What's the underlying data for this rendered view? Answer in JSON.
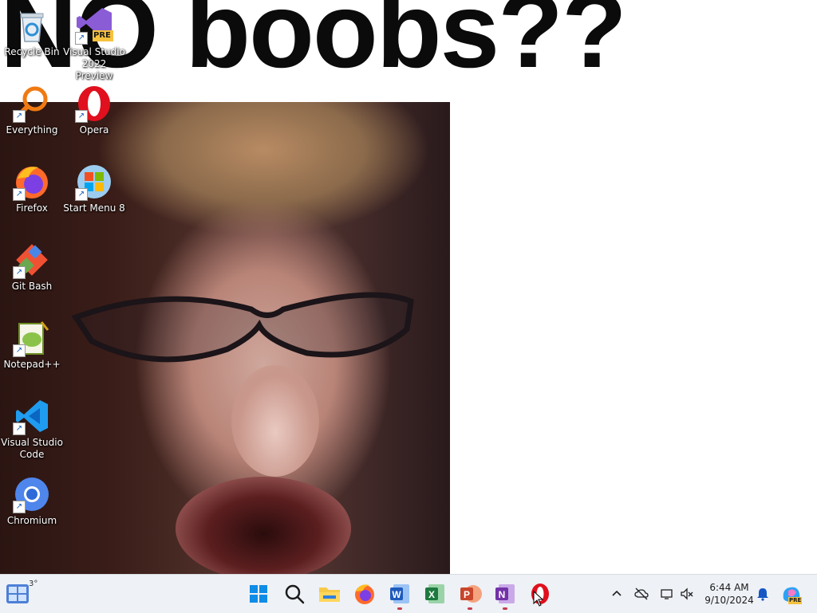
{
  "wallpaper": {
    "headline": "NO boobs??"
  },
  "desktop_icons": [
    {
      "label": "Recycle Bin",
      "icon": "recycle-bin-icon"
    },
    {
      "label": "Visual Studio 2022 Preview",
      "icon": "visual-studio-preview-icon",
      "badge": "PRE"
    },
    {
      "label": "Everything",
      "icon": "everything-search-icon"
    },
    {
      "label": "Opera",
      "icon": "opera-icon"
    },
    {
      "label": "Firefox",
      "icon": "firefox-icon"
    },
    {
      "label": "Start Menu 8",
      "icon": "start-menu-8-icon"
    },
    {
      "label": "Git Bash",
      "icon": "git-bash-icon"
    },
    {
      "label": "Notepad++",
      "icon": "notepad-plus-plus-icon"
    },
    {
      "label": "Visual Studio Code",
      "icon": "vscode-icon"
    },
    {
      "label": "Chromium",
      "icon": "chromium-icon"
    }
  ],
  "taskbar": {
    "weather": "3°",
    "pinned": [
      {
        "name": "start",
        "icon": "windows-start-icon"
      },
      {
        "name": "search",
        "icon": "search-icon"
      },
      {
        "name": "file-explorer",
        "icon": "folder-icon"
      },
      {
        "name": "firefox",
        "icon": "firefox-icon"
      },
      {
        "name": "word",
        "icon": "word-icon",
        "letter": "W"
      },
      {
        "name": "excel",
        "icon": "excel-icon",
        "letter": "X"
      },
      {
        "name": "powerpoint",
        "icon": "powerpoint-icon",
        "letter": "P"
      },
      {
        "name": "onenote",
        "icon": "onenote-icon",
        "letter": "N"
      },
      {
        "name": "opera",
        "icon": "opera-icon"
      }
    ],
    "tray": {
      "time": "6:44 AM",
      "date": "9/10/2024",
      "copilot_badge": "PRE"
    }
  },
  "colors": {
    "taskbar_bg": "#eef1f6",
    "accent_blue": "#0067c0",
    "running_indicator": "#c43b4b"
  }
}
